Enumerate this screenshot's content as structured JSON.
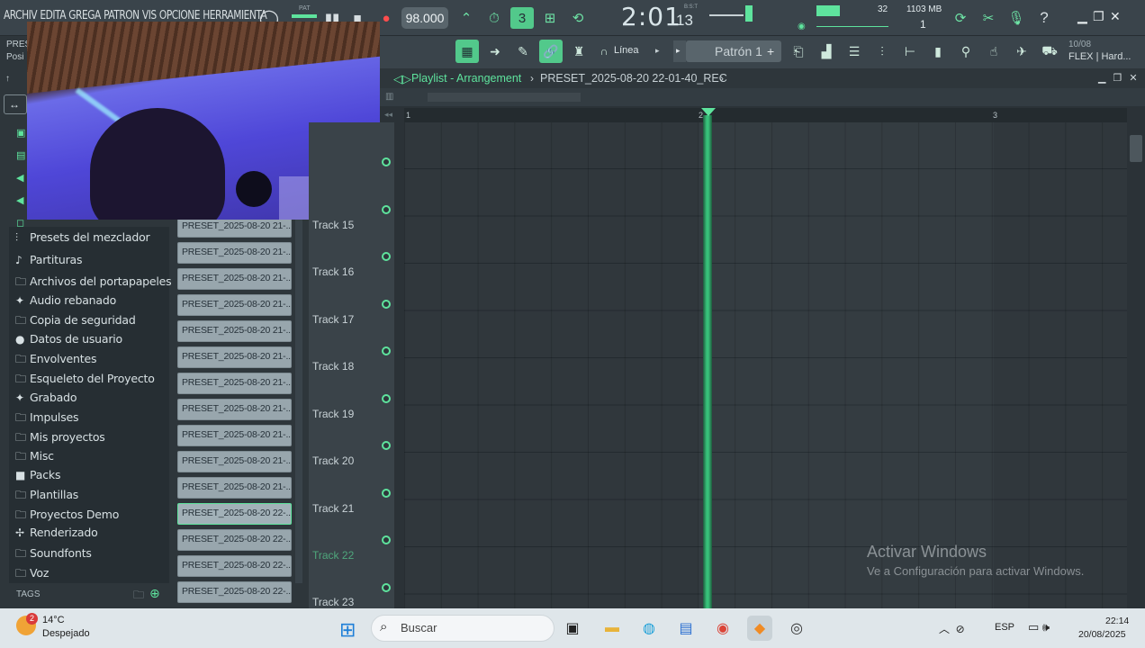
{
  "menu": {
    "items": [
      "ARCHIV",
      "EDITA",
      "GREGA",
      "PATRON",
      "VIS",
      "OPCIONE",
      "HERRAMIENTA"
    ]
  },
  "transport": {
    "pat_label": "PAT",
    "tempo": "98.000",
    "time_main": "2:01",
    "time_sub": "13",
    "time_unit": "B:S:T",
    "cpu_value": "32",
    "memory": "1103 MB",
    "memory_count": "1"
  },
  "toolbar2": {
    "snap_label": "Línea",
    "pattern_label": "Patrón 1",
    "hint_date": "10/08",
    "hint_text": "FLEX | Hard..."
  },
  "left_hint": {
    "line1": "PRES",
    "line2": "Posi"
  },
  "browser": {
    "items": [
      {
        "label": "Presets del mezclador",
        "icon": "mixer-icon"
      },
      {
        "label": "Partituras",
        "icon": "note-icon"
      },
      {
        "label": "Archivos del portapapeles",
        "icon": "folder-icon"
      },
      {
        "label": "Audio rebanado",
        "icon": "audio-icon"
      },
      {
        "label": "Copia de seguridad",
        "icon": "backup-folder-icon"
      },
      {
        "label": "Datos de usuario",
        "icon": "user-icon"
      },
      {
        "label": "Envolventes",
        "icon": "folder-icon"
      },
      {
        "label": "Esqueleto del Proyecto",
        "icon": "folder-icon"
      },
      {
        "label": "Grabado",
        "icon": "audio-icon"
      },
      {
        "label": "Impulses",
        "icon": "folder-icon"
      },
      {
        "label": "Mis proyectos",
        "icon": "folder-icon"
      },
      {
        "label": "Misc",
        "icon": "folder-icon"
      },
      {
        "label": "Packs",
        "icon": "packs-folder-icon"
      },
      {
        "label": "Plantillas",
        "icon": "folder-icon"
      },
      {
        "label": "Proyectos Demo",
        "icon": "folder-icon"
      },
      {
        "label": "Renderizado",
        "icon": "render-icon"
      },
      {
        "label": "Soundfonts",
        "icon": "folder-icon"
      },
      {
        "label": "Voz",
        "icon": "folder-icon"
      }
    ],
    "tags_label": "TAGS"
  },
  "clips": [
    "PRESET_2025-08-20 21-...",
    "PRESET_2025-08-20 21-...",
    "PRESET_2025-08-20 21-...",
    "PRESET_2025-08-20 21-...",
    "PRESET_2025-08-20 21-...",
    "PRESET_2025-08-20 21-...",
    "PRESET_2025-08-20 21-...",
    "PRESET_2025-08-20 21-...",
    "PRESET_2025-08-20 21-...",
    "PRESET_2025-08-20 21-...",
    "PRESET_2025-08-20 21-...",
    "PRESET_2025-08-20 22-...",
    "PRESET_2025-08-20 22-...",
    "PRESET_2025-08-20 22-...",
    "PRESET_2025-08-20 22-..."
  ],
  "selected_clip_index": 11,
  "playlist": {
    "title": "Playlist - Arrangement",
    "separator": "›",
    "file": "PRESET_2025-08-20 22-01-40_REC",
    "ruler": [
      "1",
      "2",
      "3"
    ],
    "tracks": [
      "Track 15",
      "Track 16",
      "Track 17",
      "Track 18",
      "Track 19",
      "Track 20",
      "Track 21",
      "Track 22",
      "Track 23"
    ],
    "active_track": "Track 22"
  },
  "watermark": {
    "title": "Activar Windows",
    "subtitle": "Ve a Configuración para activar Windows."
  },
  "taskbar": {
    "weather_badge": "2",
    "temperature": "14°C",
    "weather": "Despejado",
    "search_placeholder": "Buscar",
    "language": "ESP",
    "time": "22:14",
    "date": "20/08/2025"
  },
  "colors": {
    "accent": "#5ee39d",
    "panel": "#2e363b",
    "clip": "#98a6ad"
  }
}
